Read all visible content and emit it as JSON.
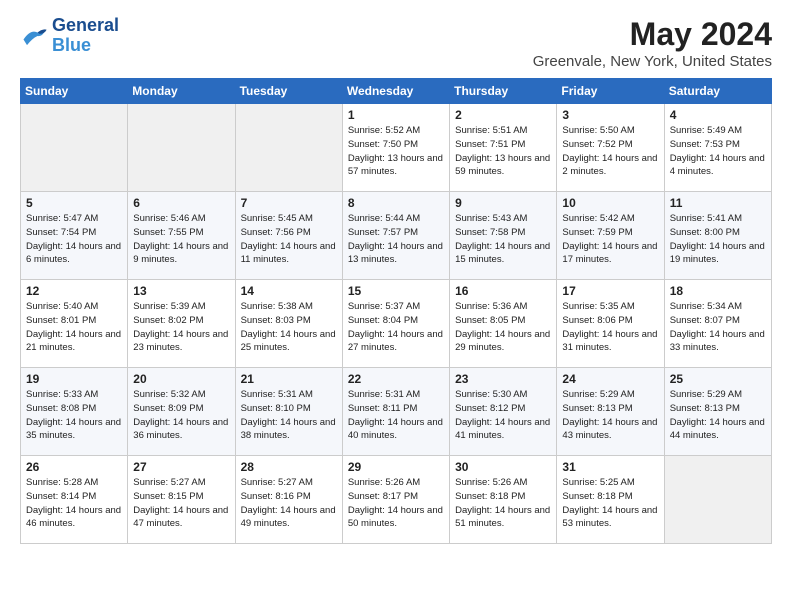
{
  "header": {
    "logo_line1": "General",
    "logo_line2": "Blue",
    "title": "May 2024",
    "subtitle": "Greenvale, New York, United States"
  },
  "weekdays": [
    "Sunday",
    "Monday",
    "Tuesday",
    "Wednesday",
    "Thursday",
    "Friday",
    "Saturday"
  ],
  "weeks": [
    [
      {
        "day": "",
        "empty": true
      },
      {
        "day": "",
        "empty": true
      },
      {
        "day": "",
        "empty": true
      },
      {
        "day": "1",
        "sunrise": "5:52 AM",
        "sunset": "7:50 PM",
        "daylight": "13 hours and 57 minutes."
      },
      {
        "day": "2",
        "sunrise": "5:51 AM",
        "sunset": "7:51 PM",
        "daylight": "13 hours and 59 minutes."
      },
      {
        "day": "3",
        "sunrise": "5:50 AM",
        "sunset": "7:52 PM",
        "daylight": "14 hours and 2 minutes."
      },
      {
        "day": "4",
        "sunrise": "5:49 AM",
        "sunset": "7:53 PM",
        "daylight": "14 hours and 4 minutes."
      }
    ],
    [
      {
        "day": "5",
        "sunrise": "5:47 AM",
        "sunset": "7:54 PM",
        "daylight": "14 hours and 6 minutes."
      },
      {
        "day": "6",
        "sunrise": "5:46 AM",
        "sunset": "7:55 PM",
        "daylight": "14 hours and 9 minutes."
      },
      {
        "day": "7",
        "sunrise": "5:45 AM",
        "sunset": "7:56 PM",
        "daylight": "14 hours and 11 minutes."
      },
      {
        "day": "8",
        "sunrise": "5:44 AM",
        "sunset": "7:57 PM",
        "daylight": "14 hours and 13 minutes."
      },
      {
        "day": "9",
        "sunrise": "5:43 AM",
        "sunset": "7:58 PM",
        "daylight": "14 hours and 15 minutes."
      },
      {
        "day": "10",
        "sunrise": "5:42 AM",
        "sunset": "7:59 PM",
        "daylight": "14 hours and 17 minutes."
      },
      {
        "day": "11",
        "sunrise": "5:41 AM",
        "sunset": "8:00 PM",
        "daylight": "14 hours and 19 minutes."
      }
    ],
    [
      {
        "day": "12",
        "sunrise": "5:40 AM",
        "sunset": "8:01 PM",
        "daylight": "14 hours and 21 minutes."
      },
      {
        "day": "13",
        "sunrise": "5:39 AM",
        "sunset": "8:02 PM",
        "daylight": "14 hours and 23 minutes."
      },
      {
        "day": "14",
        "sunrise": "5:38 AM",
        "sunset": "8:03 PM",
        "daylight": "14 hours and 25 minutes."
      },
      {
        "day": "15",
        "sunrise": "5:37 AM",
        "sunset": "8:04 PM",
        "daylight": "14 hours and 27 minutes."
      },
      {
        "day": "16",
        "sunrise": "5:36 AM",
        "sunset": "8:05 PM",
        "daylight": "14 hours and 29 minutes."
      },
      {
        "day": "17",
        "sunrise": "5:35 AM",
        "sunset": "8:06 PM",
        "daylight": "14 hours and 31 minutes."
      },
      {
        "day": "18",
        "sunrise": "5:34 AM",
        "sunset": "8:07 PM",
        "daylight": "14 hours and 33 minutes."
      }
    ],
    [
      {
        "day": "19",
        "sunrise": "5:33 AM",
        "sunset": "8:08 PM",
        "daylight": "14 hours and 35 minutes."
      },
      {
        "day": "20",
        "sunrise": "5:32 AM",
        "sunset": "8:09 PM",
        "daylight": "14 hours and 36 minutes."
      },
      {
        "day": "21",
        "sunrise": "5:31 AM",
        "sunset": "8:10 PM",
        "daylight": "14 hours and 38 minutes."
      },
      {
        "day": "22",
        "sunrise": "5:31 AM",
        "sunset": "8:11 PM",
        "daylight": "14 hours and 40 minutes."
      },
      {
        "day": "23",
        "sunrise": "5:30 AM",
        "sunset": "8:12 PM",
        "daylight": "14 hours and 41 minutes."
      },
      {
        "day": "24",
        "sunrise": "5:29 AM",
        "sunset": "8:13 PM",
        "daylight": "14 hours and 43 minutes."
      },
      {
        "day": "25",
        "sunrise": "5:29 AM",
        "sunset": "8:13 PM",
        "daylight": "14 hours and 44 minutes."
      }
    ],
    [
      {
        "day": "26",
        "sunrise": "5:28 AM",
        "sunset": "8:14 PM",
        "daylight": "14 hours and 46 minutes."
      },
      {
        "day": "27",
        "sunrise": "5:27 AM",
        "sunset": "8:15 PM",
        "daylight": "14 hours and 47 minutes."
      },
      {
        "day": "28",
        "sunrise": "5:27 AM",
        "sunset": "8:16 PM",
        "daylight": "14 hours and 49 minutes."
      },
      {
        "day": "29",
        "sunrise": "5:26 AM",
        "sunset": "8:17 PM",
        "daylight": "14 hours and 50 minutes."
      },
      {
        "day": "30",
        "sunrise": "5:26 AM",
        "sunset": "8:18 PM",
        "daylight": "14 hours and 51 minutes."
      },
      {
        "day": "31",
        "sunrise": "5:25 AM",
        "sunset": "8:18 PM",
        "daylight": "14 hours and 53 minutes."
      },
      {
        "day": "",
        "empty": true
      }
    ]
  ]
}
